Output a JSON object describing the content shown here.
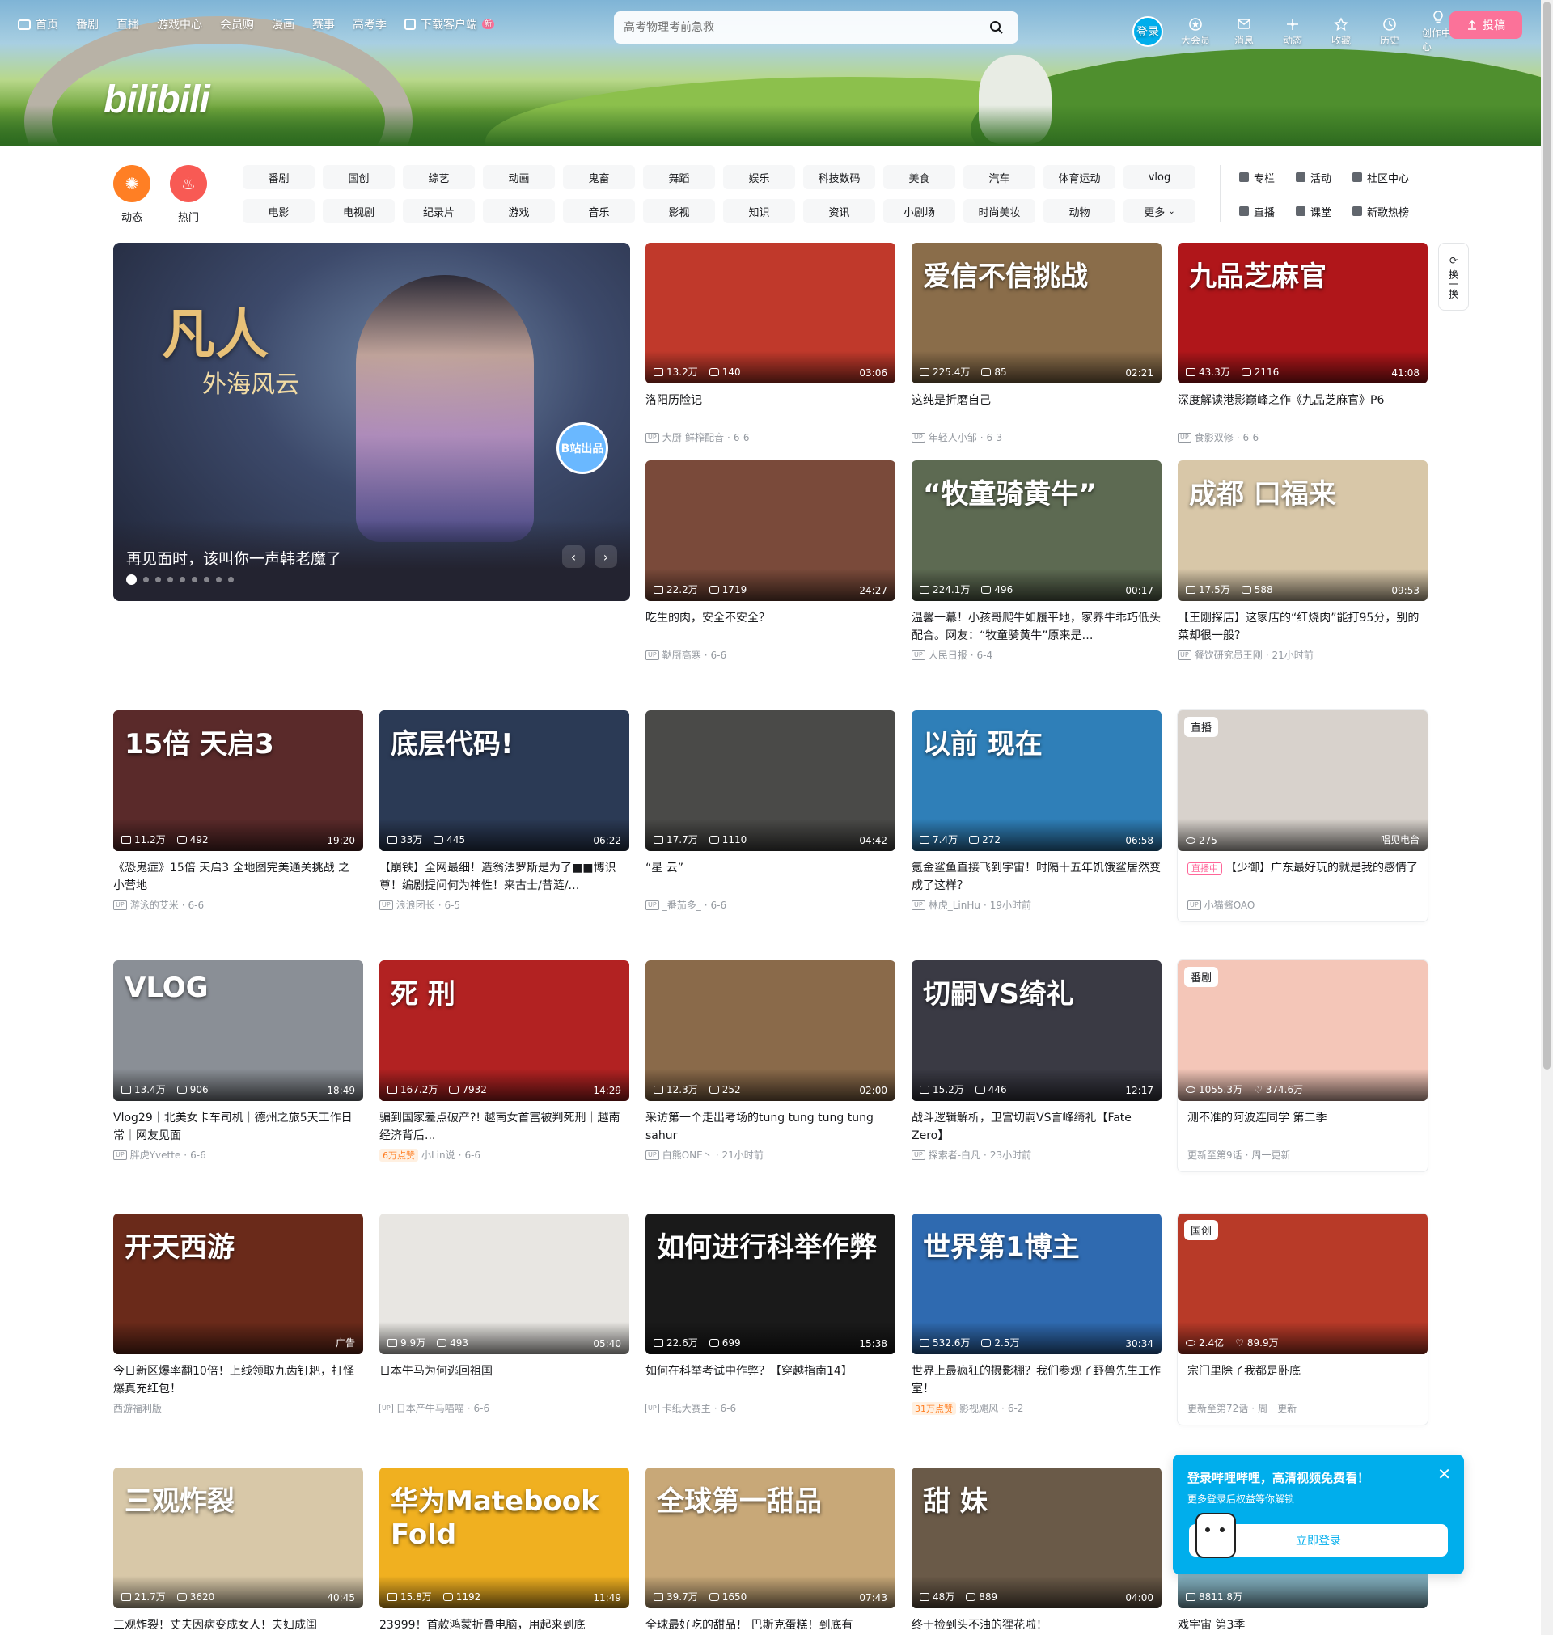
{
  "topnav": {
    "items": [
      "首页",
      "番剧",
      "直播",
      "游戏中心",
      "会员购",
      "漫画",
      "赛事",
      "高考季"
    ],
    "download": "下载客户端",
    "download_badge": "新"
  },
  "search": {
    "placeholder": "高考物理考前急救"
  },
  "user_nav": {
    "login": "登录",
    "items": [
      "大会员",
      "消息",
      "动态",
      "收藏",
      "历史",
      "创作中心"
    ],
    "upload": "投稿"
  },
  "quick": {
    "dynamic": "动态",
    "hot": "热门"
  },
  "channels": [
    "番剧",
    "国创",
    "综艺",
    "动画",
    "鬼畜",
    "舞蹈",
    "娱乐",
    "科技数码",
    "美食",
    "汽车",
    "体育运动",
    "vlog",
    "电影",
    "电视剧",
    "纪录片",
    "游戏",
    "音乐",
    "影视",
    "知识",
    "资讯",
    "小剧场",
    "时尚美妆",
    "动物",
    "更多"
  ],
  "side_links": [
    "专栏",
    "活动",
    "社区中心",
    "直播",
    "课堂",
    "新歌热榜"
  ],
  "carousel": {
    "title": "再见面时，该叫你一声韩老魔了",
    "calli": "凡人",
    "calli_sub": "外海风云",
    "badge": "B站出品",
    "slides": 9
  },
  "refresh": "换一换",
  "row1": [
    {
      "title": "洛阳历险记",
      "views": "13.2万",
      "danmaku": "140",
      "duration": "03:06",
      "author": "大厨-鲜榨配音",
      "date": "6-6",
      "bg": "#c0392b"
    },
    {
      "title": "这纯是折磨自己",
      "views": "225.4万",
      "danmaku": "85",
      "duration": "02:21",
      "author": "年轻人小邹",
      "date": "6-3",
      "bg": "#8a6d4a",
      "overlay": "爱信不信挑战"
    },
    {
      "title": "深度解读港影巅峰之作《九品芝麻官》P6",
      "views": "43.3万",
      "danmaku": "2116",
      "duration": "41:08",
      "author": "食影双修",
      "date": "6-6",
      "bg": "#b0161a",
      "overlay": "九品芝麻官"
    },
    {
      "title": "吃生的肉，安全不安全？",
      "views": "22.2万",
      "danmaku": "1719",
      "duration": "24:27",
      "author": "鞑厨高寒",
      "date": "6-6",
      "bg": "#7a4a3a"
    },
    {
      "title": "温馨一幕！小孩哥爬牛如履平地，家养牛乖巧低头配合。网友：“牧童骑黄牛”原来是…",
      "views": "224.1万",
      "danmaku": "496",
      "duration": "00:17",
      "author": "人民日报",
      "date": "6-4",
      "bg": "#5d6a52",
      "overlay": "“牧童骑黄牛”"
    },
    {
      "title": "【王刚探店】这家店的“红烧肉”能打95分，别的菜却很一般？",
      "views": "17.5万",
      "danmaku": "588",
      "duration": "09:53",
      "author": "餐饮研究员王刚",
      "date": "21小时前",
      "bg": "#d8c7a8",
      "overlay": "成都 口福来"
    }
  ],
  "row2": [
    {
      "title": "《恐鬼症》15倍 天启3 全地图完美通关挑战 之 小营地",
      "views": "11.2万",
      "danmaku": "492",
      "duration": "19:20",
      "author": "游泳的艾米",
      "date": "6-6",
      "bg": "#5a2a2a",
      "overlay": "15倍 天启3"
    },
    {
      "title": "【崩铁】全网最细！造翁法罗斯是为了■■博识尊！编剧提问何为神性！来古士/昔涟/…",
      "views": "33万",
      "danmaku": "445",
      "duration": "06:22",
      "author": "浪浪团长",
      "date": "6-5",
      "bg": "#2b3a55",
      "overlay": "底层代码!"
    },
    {
      "title": "“星 云”",
      "views": "17.7万",
      "danmaku": "1110",
      "duration": "04:42",
      "author": "_番茄多_",
      "date": "6-6",
      "bg": "#4a4a48"
    },
    {
      "title": "氪金鲨鱼直接飞到宇宙！时隔十五年饥饿鲨居然变成了这样？",
      "views": "7.4万",
      "danmaku": "272",
      "duration": "06:58",
      "author": "林虎_LinHu",
      "date": "19小时前",
      "bg": "#2f7fb8",
      "overlay": "以前 现在"
    },
    {
      "title": "【少御】广东最好玩的就是我的感情了",
      "views": "275",
      "duration": "",
      "author": "小猫酱OAO",
      "date": "",
      "bg": "#d8d2cc",
      "tag": "直播",
      "live_tag": "直播中",
      "corner": "唱见电台"
    }
  ],
  "row3": [
    {
      "title": "Vlog29｜北美女卡车司机｜德州之旅5天工作日常｜网友见面",
      "views": "13.4万",
      "danmaku": "906",
      "duration": "18:49",
      "author": "胖虎Yvette",
      "date": "6-6",
      "bg": "#8a8f96",
      "overlay": "VLOG"
    },
    {
      "title": "骗到国家差点破产?! 越南女首富被判死刑｜越南经济背后...",
      "views": "167.2万",
      "danmaku": "7932",
      "duration": "14:29",
      "author": "小Lin说",
      "date": "6-6",
      "bg": "#b22222",
      "overlay": "死 刑",
      "hot": "6万点赞"
    },
    {
      "title": "采访第一个走出考场的tung tung tung tung sahur",
      "views": "12.3万",
      "danmaku": "252",
      "duration": "02:00",
      "author": "白熊ONE丶",
      "date": "21小时前",
      "bg": "#8a6a4a"
    },
    {
      "title": "战斗逻辑解析，卫宫切嗣VS言峰绮礼【Fate Zero】",
      "views": "15.2万",
      "danmaku": "446",
      "duration": "12:17",
      "author": "探索者-白凡",
      "date": "23小时前",
      "bg": "#3a3a44",
      "overlay": "切嗣VS绮礼"
    },
    {
      "title": "测不准的阿波连同学 第二季",
      "views": "1055.3万",
      "likes": "374.6万",
      "author": "",
      "bg": "#f4c6b8",
      "tag": "番剧",
      "update": "更新至第9话",
      "schedule": "周一更新"
    }
  ],
  "row4": [
    {
      "title": "今日新区爆率翻10倍！上线领取九齿钉耙，打怪爆真充红包！",
      "views": "",
      "danmaku": "",
      "duration": "",
      "author": "西游福利版",
      "date": "",
      "bg": "#6a2a1a",
      "overlay": "开天西游",
      "ad": "广告"
    },
    {
      "title": "日本牛马为何逃回祖国",
      "views": "9.9万",
      "danmaku": "493",
      "duration": "05:40",
      "author": "日本产牛马喵喵",
      "date": "6-6",
      "bg": "#e8e6e2"
    },
    {
      "title": "如何在科举考试中作弊？【穿越指南14】",
      "views": "22.6万",
      "danmaku": "699",
      "duration": "15:38",
      "author": "卡纸大赛主",
      "date": "6-6",
      "bg": "#1a1a1a",
      "overlay": "如何进行科举作弊"
    },
    {
      "title": "世界上最疯狂的摄影棚？我们参观了野兽先生工作室！",
      "views": "532.6万",
      "danmaku": "2.5万",
      "duration": "30:34",
      "author": "影视飓风",
      "date": "6-2",
      "bg": "#2f6ab0",
      "overlay": "世界第1博主",
      "hot": "31万点赞"
    },
    {
      "title": "宗门里除了我都是卧底",
      "views": "2.4亿",
      "likes": "89.9万",
      "author": "",
      "bg": "#b83a28",
      "tag": "国创",
      "update": "更新至第72话",
      "schedule": "周一更新"
    }
  ],
  "row5": [
    {
      "title": "三观炸裂！丈夫因病变成女人！夫妇成闺",
      "views": "21.7万",
      "danmaku": "3620",
      "duration": "40:45",
      "bg": "#d8c8a8",
      "overlay": "三观炸裂"
    },
    {
      "title": "23999！首款鸿蒙折叠电脑，用起来到底",
      "views": "15.8万",
      "danmaku": "1192",
      "duration": "11:49",
      "bg": "#f0b020",
      "overlay": "华为Matebook Fold"
    },
    {
      "title": "全球最好吃的甜品！ 巴斯克蛋糕！到底有",
      "views": "39.7万",
      "danmaku": "1650",
      "duration": "07:43",
      "bg": "#c8a878",
      "overlay": "全球第一甜品"
    },
    {
      "title": "终于捡到头不油的狸花啦！",
      "views": "48万",
      "danmaku": "889",
      "duration": "04:00",
      "bg": "#6a5a48",
      "overlay": "甜 妹"
    },
    {
      "title": "戏宇宙 第3季",
      "views": "8811.8万",
      "bg": "#88b8c8"
    }
  ],
  "popup": {
    "title": "登录哔哩哔哩，高清视频免费看！",
    "subtitle": "更多登录后权益等你解锁",
    "button": "立即登录"
  }
}
